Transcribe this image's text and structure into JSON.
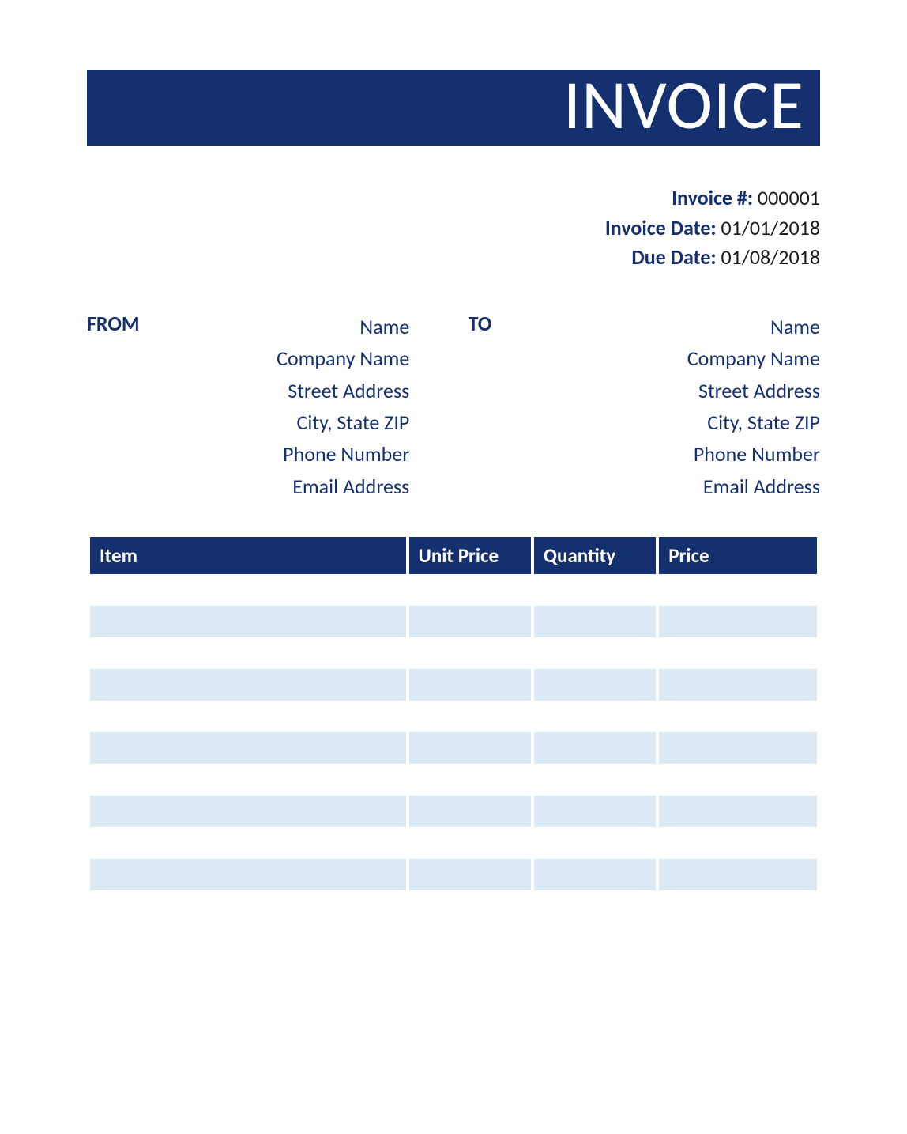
{
  "header": {
    "title": "INVOICE"
  },
  "meta": {
    "invoice_number_label": "Invoice #:",
    "invoice_number_value": "000001",
    "invoice_date_label": "Invoice Date:",
    "invoice_date_value": "01/01/2018",
    "due_date_label": "Due Date:",
    "due_date_value": "01/08/2018"
  },
  "from": {
    "label": "FROM",
    "fields": [
      "Name",
      "Company Name",
      "Street Address",
      "City, State ZIP",
      "Phone Number",
      "Email Address"
    ]
  },
  "to": {
    "label": "TO",
    "fields": [
      "Name",
      "Company Name",
      "Street Address",
      "City, State ZIP",
      "Phone Number",
      "Email Address"
    ]
  },
  "table": {
    "headers": {
      "item": "Item",
      "unit_price": "Unit Price",
      "quantity": "Quantity",
      "price": "Price"
    },
    "rows": [
      {
        "item": "",
        "unit_price": "",
        "quantity": "",
        "price": ""
      },
      {
        "item": "",
        "unit_price": "",
        "quantity": "",
        "price": ""
      },
      {
        "item": "",
        "unit_price": "",
        "quantity": "",
        "price": ""
      },
      {
        "item": "",
        "unit_price": "",
        "quantity": "",
        "price": ""
      },
      {
        "item": "",
        "unit_price": "",
        "quantity": "",
        "price": ""
      },
      {
        "item": "",
        "unit_price": "",
        "quantity": "",
        "price": ""
      },
      {
        "item": "",
        "unit_price": "",
        "quantity": "",
        "price": ""
      },
      {
        "item": "",
        "unit_price": "",
        "quantity": "",
        "price": ""
      },
      {
        "item": "",
        "unit_price": "",
        "quantity": "",
        "price": ""
      },
      {
        "item": "",
        "unit_price": "",
        "quantity": "",
        "price": ""
      },
      {
        "item": "",
        "unit_price": "",
        "quantity": "",
        "price": ""
      }
    ]
  }
}
